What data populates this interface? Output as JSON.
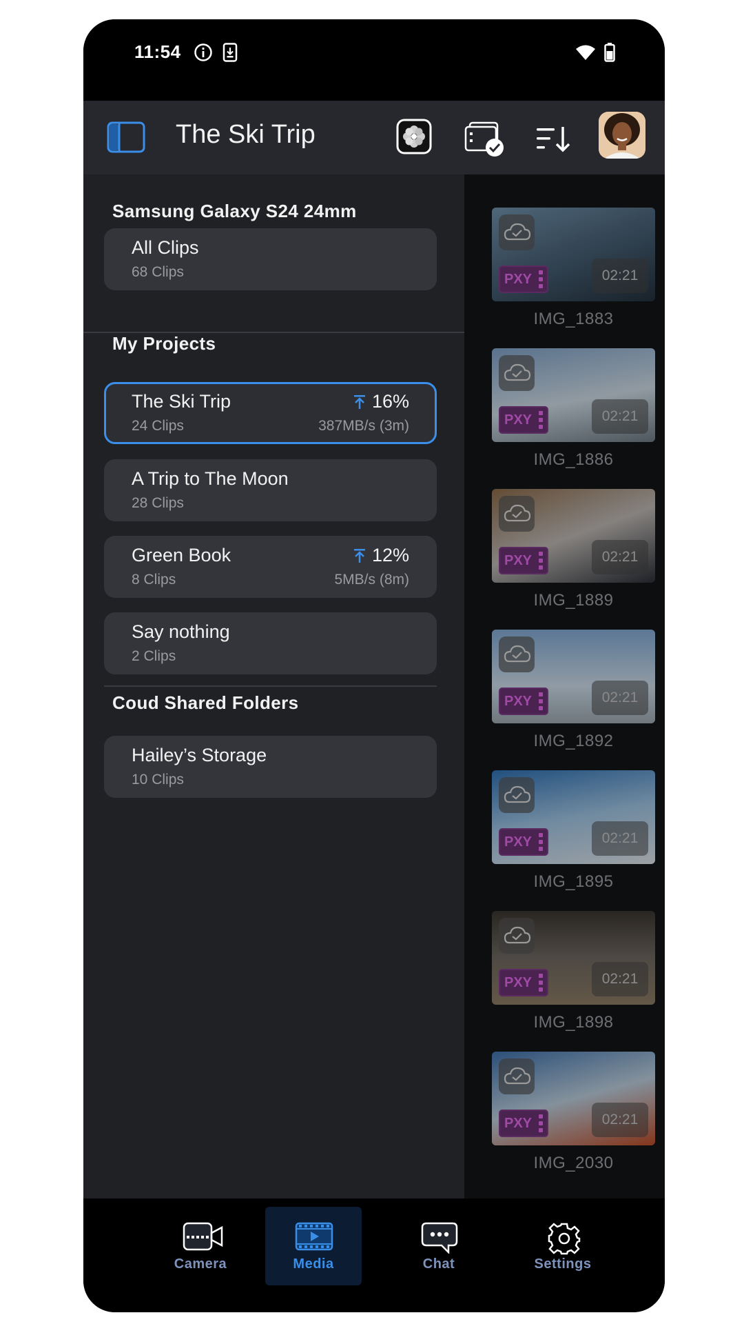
{
  "status_bar": {
    "time": "11:54"
  },
  "app_bar": {
    "title": "The Ski Trip"
  },
  "sidebar": {
    "device_header": "Samsung Galaxy S24 24mm",
    "all_clips": {
      "title": "All Clips",
      "count": "68 Clips"
    },
    "projects_header": "My Projects",
    "projects": [
      {
        "title": "The Ski Trip",
        "count": "24 Clips",
        "progress": "16%",
        "rate": "387MB/s (3m)",
        "selected": true
      },
      {
        "title": "A Trip to The Moon",
        "count": "28 Clips"
      },
      {
        "title": "Green Book",
        "count": "8 Clips",
        "progress": "12%",
        "rate": "5MB/s (8m)"
      },
      {
        "title": "Say nothing",
        "count": "2 Clips"
      }
    ],
    "shared_header": "Coud Shared Folders",
    "shared": [
      {
        "title": "Hailey’s Storage",
        "count": "10 Clips"
      }
    ]
  },
  "clips": [
    {
      "name": "IMG_1883",
      "badge": "PXY",
      "duration": "02:21"
    },
    {
      "name": "IMG_1886",
      "badge": "PXY",
      "duration": "02:21"
    },
    {
      "name": "IMG_1889",
      "badge": "PXY",
      "duration": "02:21"
    },
    {
      "name": "IMG_1892",
      "badge": "PXY",
      "duration": "02:21"
    },
    {
      "name": "IMG_1895",
      "badge": "PXY",
      "duration": "02:21"
    },
    {
      "name": "IMG_1898",
      "badge": "PXY",
      "duration": "02:21"
    },
    {
      "name": "IMG_2030",
      "badge": "PXY",
      "duration": "02:21"
    }
  ],
  "nav": [
    {
      "label": "Camera",
      "icon": "video-camera-icon"
    },
    {
      "label": "Media",
      "icon": "film-icon",
      "active": true
    },
    {
      "label": "Chat",
      "icon": "chat-bubble-icon"
    },
    {
      "label": "Settings",
      "icon": "gear-icon"
    }
  ],
  "colors": {
    "accent": "#3b8fea",
    "pxy": "#a04aa6",
    "background": "#202125"
  }
}
